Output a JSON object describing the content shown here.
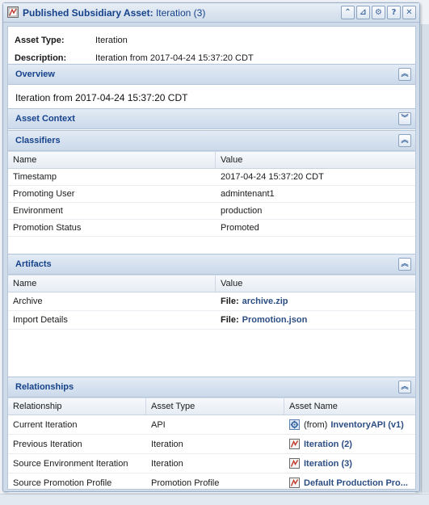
{
  "window": {
    "title": "Published Subsidiary Asset:",
    "subtitle": "Iteration (3)",
    "tools": [
      "collapse-tool",
      "graph-tool",
      "gear-tool",
      "help-tool",
      "close-tool"
    ],
    "tool_glyphs": [
      "⌃",
      "⊿",
      "⚙",
      "?",
      "✕"
    ]
  },
  "meta": {
    "asset_type_label": "Asset Type:",
    "asset_type_value": "Iteration",
    "description_label": "Description:",
    "description_value": "Iteration from 2017-04-24 15:37:20 CDT"
  },
  "overview": {
    "title": "Overview",
    "text": "Iteration from 2017-04-24 15:37:20 CDT"
  },
  "asset_context": {
    "title": "Asset Context"
  },
  "classifiers": {
    "title": "Classifiers",
    "columns": [
      "Name",
      "Value"
    ],
    "rows": [
      [
        "Timestamp",
        "2017-04-24 15:37:20 CDT"
      ],
      [
        "Promoting User",
        "admintenant1"
      ],
      [
        "Environment",
        "production"
      ],
      [
        "Promotion Status",
        "Promoted"
      ]
    ]
  },
  "artifacts": {
    "title": "Artifacts",
    "columns": [
      "Name",
      "Value"
    ],
    "file_label": "File:",
    "rows": [
      {
        "name": "Archive",
        "file": "archive.zip"
      },
      {
        "name": "Import Details",
        "file": "Promotion.json"
      }
    ]
  },
  "relationships": {
    "title": "Relationships",
    "columns": [
      "Relationship",
      "Asset Type",
      "Asset Name"
    ],
    "rows": [
      {
        "relationship": "Current Iteration",
        "type": "API",
        "prefix": "(from)",
        "name": "InventoryAPI (v1)",
        "icon": "api-gear-icon"
      },
      {
        "relationship": "Previous Iteration",
        "type": "Iteration",
        "prefix": "",
        "name": "Iteration (2)",
        "icon": "asset-icon"
      },
      {
        "relationship": "Source Environment Iteration",
        "type": "Iteration",
        "prefix": "",
        "name": "Iteration (3)",
        "icon": "asset-icon"
      },
      {
        "relationship": "Source Promotion Profile",
        "type": "Promotion Profile",
        "prefix": "",
        "name": "Default Production Pro...",
        "icon": "asset-icon"
      }
    ]
  },
  "colors": {
    "header_text": "#15428b",
    "link_text": "#2d4e83"
  }
}
